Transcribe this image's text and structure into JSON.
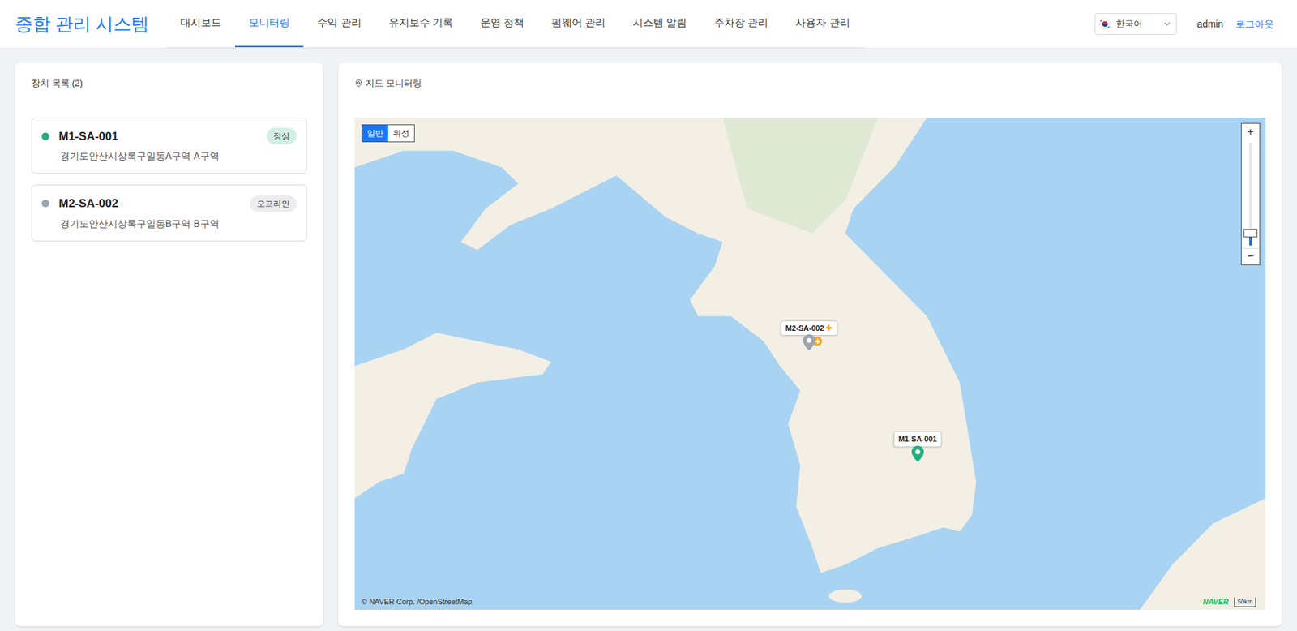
{
  "header": {
    "title": "종합 관리 시스템",
    "nav": [
      {
        "label": "대시보드",
        "selected": false
      },
      {
        "label": "모니터링",
        "selected": true
      },
      {
        "label": "수익 관리",
        "selected": false
      },
      {
        "label": "유지보수 기록",
        "selected": false
      },
      {
        "label": "운영 정책",
        "selected": false
      },
      {
        "label": "펌웨어 관리",
        "selected": false
      },
      {
        "label": "시스템 알림",
        "selected": false
      },
      {
        "label": "주차장 관리",
        "selected": false
      },
      {
        "label": "사용자 관리",
        "selected": false
      }
    ],
    "language": "한국어",
    "user": "admin",
    "logout": "로그아웃"
  },
  "device_list": {
    "title": "장치 목록 (2)",
    "devices": [
      {
        "name": "M1-SA-001",
        "address": "경기도안산시상록구일동A구역 A구역",
        "status": "정상",
        "color": "#22b07d"
      },
      {
        "name": "M2-SA-002",
        "address": "경기도안산시상록구일동B구역 B구역",
        "status": "오프라인",
        "color": "#9ca3af"
      }
    ]
  },
  "map": {
    "title": "지도 모니터링",
    "map_types": [
      {
        "label": "일반",
        "selected": true
      },
      {
        "label": "위성",
        "selected": false
      }
    ],
    "zoom_in": "+",
    "zoom_out": "−",
    "zoom_level": 0.12,
    "markers": [
      {
        "label": "M2-SA-002",
        "charging": true,
        "color": "#9ca3af"
      },
      {
        "label": "M1-SA-001",
        "charging": false,
        "color": "#22b07d"
      }
    ],
    "attribution": "© NAVER Corp. /OpenStreetMap",
    "logo": "NAVER",
    "scale": "50km"
  }
}
